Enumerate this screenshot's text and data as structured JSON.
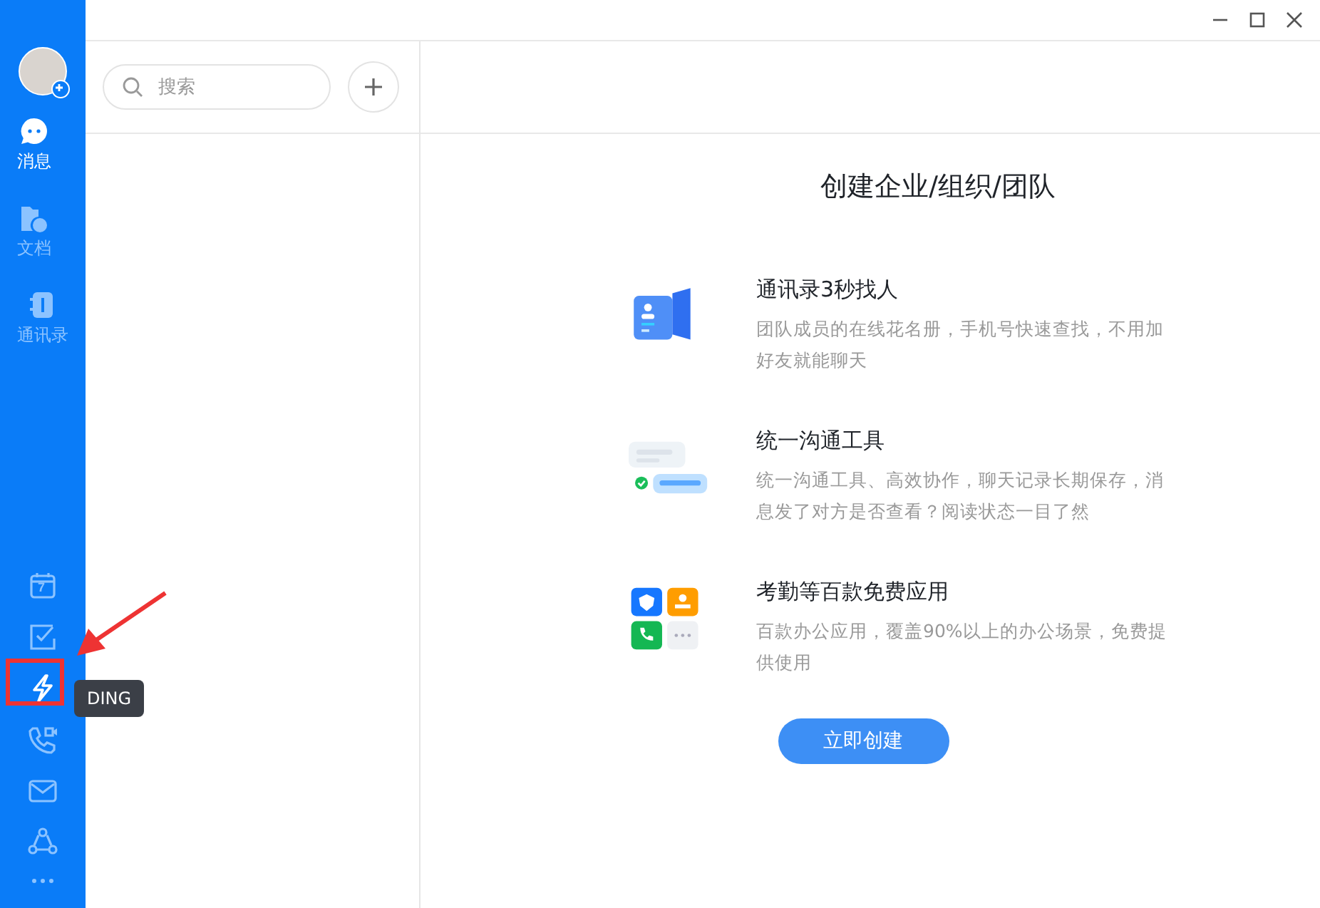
{
  "sidebar": {
    "nav": [
      {
        "kind": "chat",
        "label": "消息",
        "selected": true
      },
      {
        "kind": "docs",
        "label": "文档",
        "selected": false
      },
      {
        "kind": "contacts",
        "label": "通讯录",
        "selected": false
      }
    ],
    "tools": [
      {
        "kind": "calendar",
        "text": "7",
        "selected": false
      },
      {
        "kind": "todo",
        "selected": false
      },
      {
        "kind": "ding",
        "selected": true
      },
      {
        "kind": "call",
        "selected": false
      },
      {
        "kind": "mail",
        "selected": false
      },
      {
        "kind": "org",
        "selected": false
      },
      {
        "kind": "more",
        "selected": false
      }
    ],
    "tooltip": "DING"
  },
  "list_panel": {
    "search": {
      "placeholder": "搜索"
    }
  },
  "main": {
    "title": "创建企业/组织/团队",
    "features": [
      {
        "kind": "contacts",
        "title": "通讯录3秒找人",
        "description": "团队成员的在线花名册，手机号快速查找，不用加好友就能聊天"
      },
      {
        "kind": "chat",
        "title": "统一沟通工具",
        "description": "统一沟通工具、高效协作，聊天记录长期保存，消息发了对方是否查看？阅读状态一目了然"
      },
      {
        "kind": "apps",
        "title": "考勤等百款免费应用",
        "description": "百款办公应用，覆盖90%以上的办公场景，免费提供使用"
      }
    ],
    "button": "立即创建"
  }
}
